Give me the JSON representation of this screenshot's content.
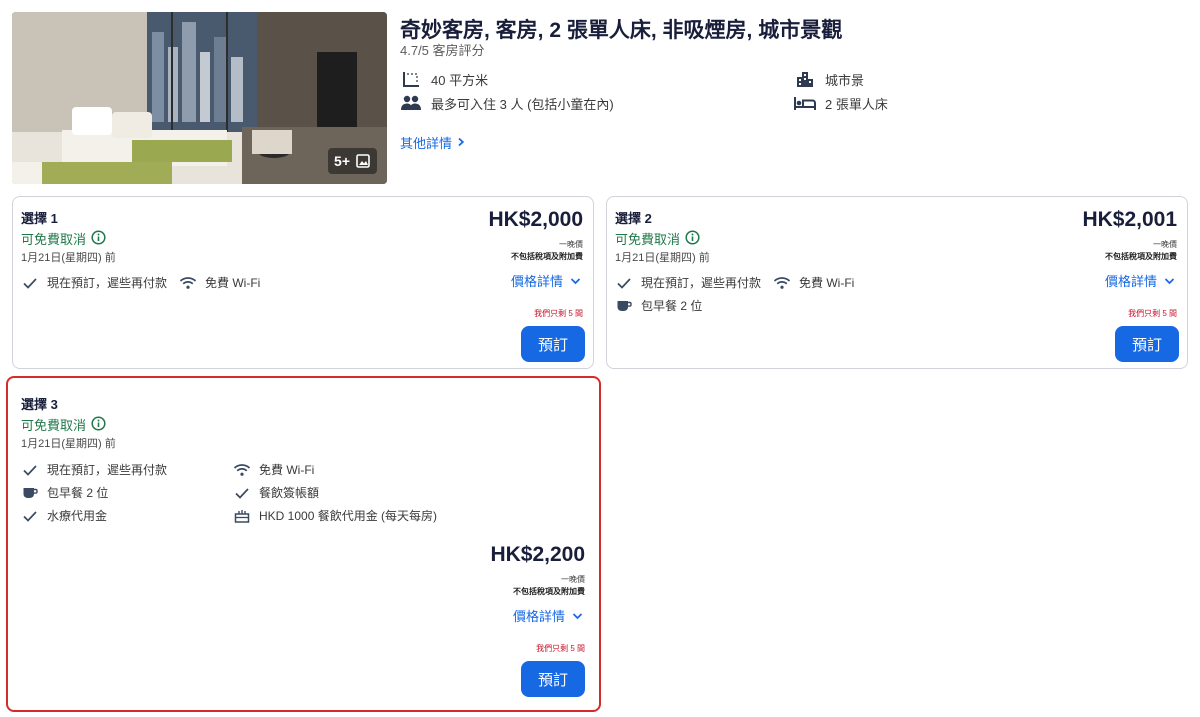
{
  "room": {
    "title": "奇妙客房, 客房, 2 張單人床, 非吸煙房, 城市景觀",
    "rating": "4.7/5 客房評分",
    "photo_count": "5+",
    "amenities": {
      "size": "40 平方米",
      "occupancy": "最多可入住 3 人 (包括小童在內)",
      "view": "城市景",
      "beds": "2 張單人床"
    },
    "details_link": "其他詳情"
  },
  "options": [
    {
      "title": "選擇 1",
      "cancellation": "可免費取消",
      "deadline": "1月21日(星期四) 前",
      "features": [
        "現在預訂，遲些再付款",
        "免費 Wi-Fi"
      ],
      "price": "HK$2,000",
      "per_night": "一晚價",
      "tax_note": "不包括稅項及附加費",
      "price_details": "價格詳情",
      "scarcity": "我們只剩 5 間",
      "book": "預訂"
    },
    {
      "title": "選擇 2",
      "cancellation": "可免費取消",
      "deadline": "1月21日(星期四) 前",
      "features": [
        "現在預訂，遲些再付款",
        "免費 Wi-Fi",
        "包早餐 2 位"
      ],
      "price": "HK$2,001",
      "per_night": "一晚價",
      "tax_note": "不包括稅項及附加費",
      "price_details": "價格詳情",
      "scarcity": "我們只剩 5 間",
      "book": "預訂"
    },
    {
      "title": "選擇 3",
      "cancellation": "可免費取消",
      "deadline": "1月21日(星期四) 前",
      "features": [
        "現在預訂，遲些再付款",
        "免費 Wi-Fi",
        "包早餐 2 位",
        "餐飲簽帳額",
        "水療代用金",
        "HKD 1000 餐飲代用金 (每天每房)"
      ],
      "price": "HK$2,200",
      "per_night": "一晚價",
      "tax_note": "不包括稅項及附加費",
      "price_details": "價格詳情",
      "scarcity": "我們只剩 5 間",
      "book": "預訂"
    }
  ],
  "colors": {
    "accent": "#1668e3",
    "title": "#191e3b",
    "free_cancel": "#20784a",
    "scarcity": "#c7162b",
    "highlight_border": "#d62b2b"
  },
  "icons": {
    "size": "floor-area-icon",
    "occupancy": "people-icon",
    "view": "city-icon",
    "beds": "bed-icon",
    "check": "check-icon",
    "wifi": "wifi-icon",
    "breakfast": "coffee-icon",
    "info": "info-icon",
    "chevron": "chevron-down-icon",
    "gallery": "gallery-icon",
    "spa_voucher": "gift-icon"
  }
}
